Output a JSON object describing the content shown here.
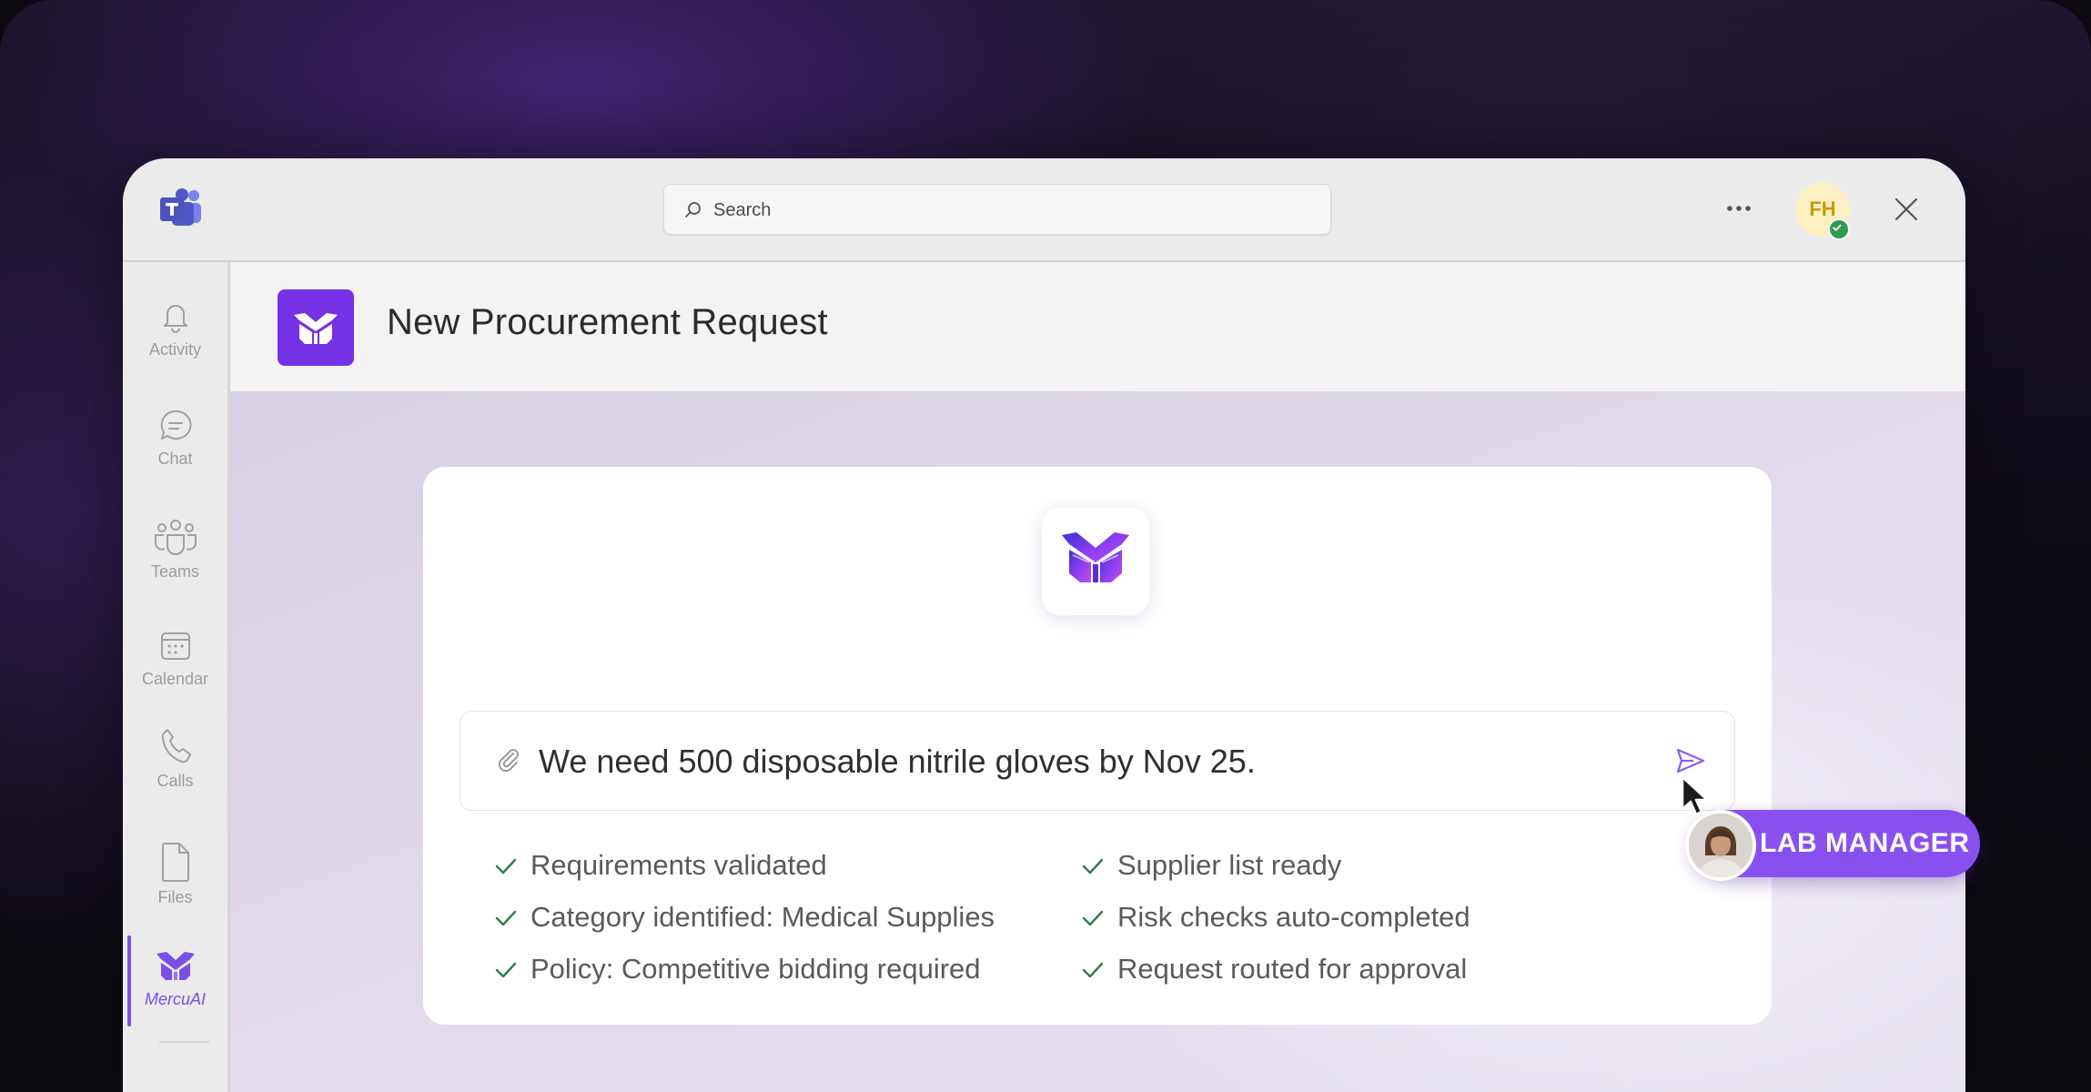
{
  "search": {
    "placeholder": "Search"
  },
  "user": {
    "initials": "FH",
    "presence": "available"
  },
  "rail": {
    "items": [
      {
        "label": "Activity",
        "icon": "bell-icon"
      },
      {
        "label": "Chat",
        "icon": "chat-icon"
      },
      {
        "label": "Teams",
        "icon": "teams-icon"
      },
      {
        "label": "Calendar",
        "icon": "calendar-icon"
      },
      {
        "label": "Calls",
        "icon": "phone-icon"
      },
      {
        "label": "Files",
        "icon": "file-icon"
      },
      {
        "label": "MercuAI",
        "icon": "mercu-logo-icon",
        "active": true
      }
    ]
  },
  "app": {
    "title": "New Procurement Request"
  },
  "prompt": {
    "text": "We need 500 disposable nitrile gloves by Nov 25."
  },
  "checks": [
    "Requirements validated",
    "Category identified: Medical Supplies",
    "Policy: Competitive bidding required",
    "Supplier list ready",
    "Risk checks auto-completed",
    "Request routed for approval"
  ],
  "badge": {
    "label": "LAB MANAGER"
  },
  "colors": {
    "accent": "#7531e6",
    "badge": "#8950f0",
    "check": "#2e7d4a",
    "presence": "#2e9b4e"
  }
}
